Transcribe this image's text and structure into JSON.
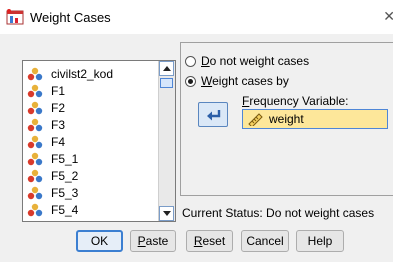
{
  "window": {
    "title": "Weight Cases",
    "close_glyph": "✕"
  },
  "variables": [
    "civilst2_kod",
    "F1",
    "F2",
    "F3",
    "F4",
    "F5_1",
    "F5_2",
    "F5_3",
    "F5_4"
  ],
  "options": {
    "no_weight": {
      "mnemonic": "D",
      "rest": "o not weight cases"
    },
    "weight_by": {
      "mnemonic": "W",
      "rest": "eight cases by"
    }
  },
  "frequency": {
    "label_mnemonic": "F",
    "label_rest": "requency Variable:",
    "value": "weight"
  },
  "status": "Current Status: Do not weight cases",
  "buttons": {
    "ok": "OK",
    "paste": {
      "mnemonic": "P",
      "rest": "aste"
    },
    "reset": {
      "mnemonic": "R",
      "rest": "eset"
    },
    "cancel": "Cancel",
    "help": "Help"
  },
  "icons": {
    "variable": "scale-variable-icon",
    "move": "move-arrow-icon",
    "ruler": "ruler-icon"
  }
}
